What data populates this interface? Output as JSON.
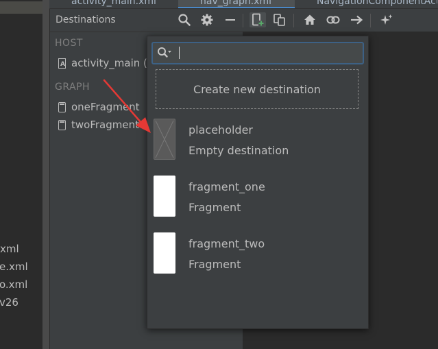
{
  "tabs": [
    {
      "label": "activity_main.xml"
    },
    {
      "label": "nav_graph.xml"
    },
    {
      "label": "NavigationComponentActivity"
    }
  ],
  "project_files": [
    "xml",
    "e.xml",
    "o.xml",
    "v26"
  ],
  "destinations_panel": {
    "title": "Destinations",
    "host_label": "HOST",
    "host_item": "activity_main (",
    "graph_label": "GRAPH",
    "graph_items": [
      "oneFragment",
      "twoFragment"
    ]
  },
  "toolbar": {
    "icons": [
      "search-icon",
      "gear-icon",
      "minus-icon",
      "new-destination-icon",
      "nested-graph-icon",
      "home-icon",
      "link-icon",
      "arrow-right-icon",
      "auto-arrange-icon"
    ]
  },
  "popup": {
    "search": {
      "value": "",
      "placeholder": ""
    },
    "create_label": "Create new destination",
    "items": [
      {
        "name": "placeholder",
        "type": "Empty destination"
      },
      {
        "name": "fragment_one",
        "type": "Fragment"
      },
      {
        "name": "fragment_two",
        "type": "Fragment"
      }
    ]
  },
  "colors": {
    "accent": "#4a88c7",
    "arrow": "#e53935",
    "panel_bg": "#3c3f41",
    "canvas_bg": "#2b2b2b",
    "add_green": "#59a869"
  }
}
